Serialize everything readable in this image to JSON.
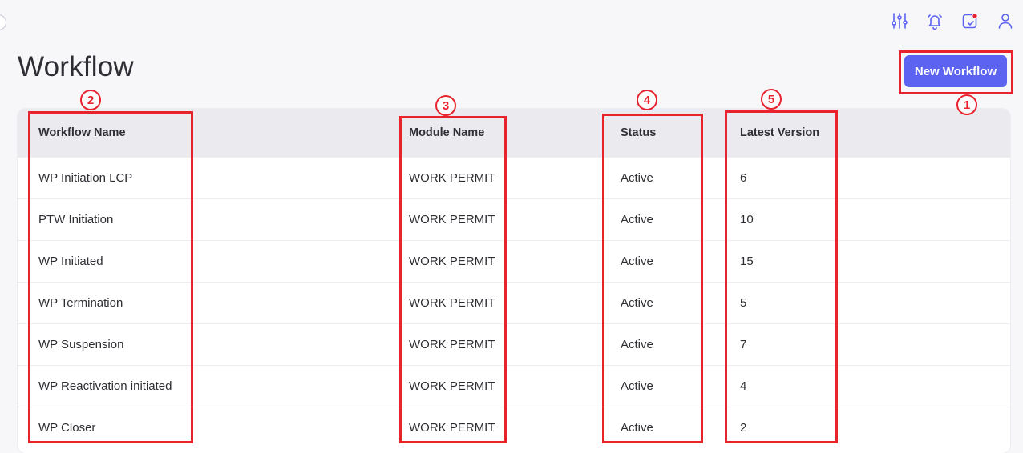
{
  "page": {
    "title": "Workflow"
  },
  "actions": {
    "new_workflow_label": "New Workflow"
  },
  "top_icons": [
    "sliders-icon",
    "bell-icon",
    "calendar-check-icon",
    "user-icon"
  ],
  "table": {
    "headers": [
      "Workflow Name",
      "Module Name",
      "Status",
      "Latest Version"
    ],
    "rows": [
      [
        "WP Initiation LCP",
        "WORK PERMIT",
        "Active",
        "6"
      ],
      [
        "PTW Initiation",
        "WORK PERMIT",
        "Active",
        "10"
      ],
      [
        "WP Initiated",
        "WORK PERMIT",
        "Active",
        "15"
      ],
      [
        "WP Termination",
        "WORK PERMIT",
        "Active",
        "5"
      ],
      [
        "WP Suspension",
        "WORK PERMIT",
        "Active",
        "7"
      ],
      [
        "WP Reactivation initiated",
        "WORK PERMIT",
        "Active",
        "4"
      ],
      [
        "WP Closer",
        "WORK PERMIT",
        "Active",
        "2"
      ]
    ]
  },
  "annotations": {
    "labels": [
      "1",
      "2",
      "3",
      "4",
      "5"
    ],
    "color": "#e8232e"
  },
  "colors": {
    "accent": "#5b63f0",
    "notification_dot": "#e8233a",
    "icon": "#5b63f0"
  }
}
